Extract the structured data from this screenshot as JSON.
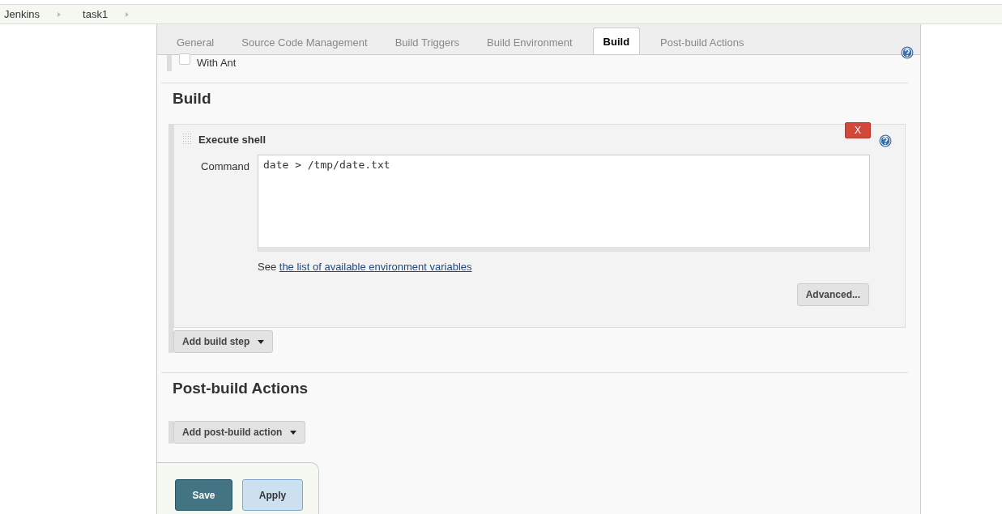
{
  "breadcrumbs": [
    {
      "label": "Jenkins"
    },
    {
      "label": "task1"
    }
  ],
  "tabs": [
    {
      "label": "General",
      "selected": false
    },
    {
      "label": "Source Code Management",
      "selected": false
    },
    {
      "label": "Build Triggers",
      "selected": false
    },
    {
      "label": "Build Environment",
      "selected": false
    },
    {
      "label": "Build",
      "selected": true
    },
    {
      "label": "Post-build Actions",
      "selected": false
    }
  ],
  "with_ant": {
    "label": "With Ant",
    "checked": false
  },
  "build_section": {
    "heading": "Build",
    "step": {
      "title": "Execute shell",
      "delete_label": "X",
      "command_label": "Command",
      "command": "date > /tmp/date.txt",
      "note_prefix": "See",
      "note_link": "the list of available environment variables",
      "advanced_button": "Advanced..."
    },
    "add_button": "Add build step"
  },
  "post_build_section": {
    "heading": "Post-build Actions",
    "add_button": "Add post-build action"
  },
  "buttons": [
    {
      "label": "Save",
      "kind": "primary"
    },
    {
      "label": "Apply",
      "kind": "secondary"
    }
  ]
}
